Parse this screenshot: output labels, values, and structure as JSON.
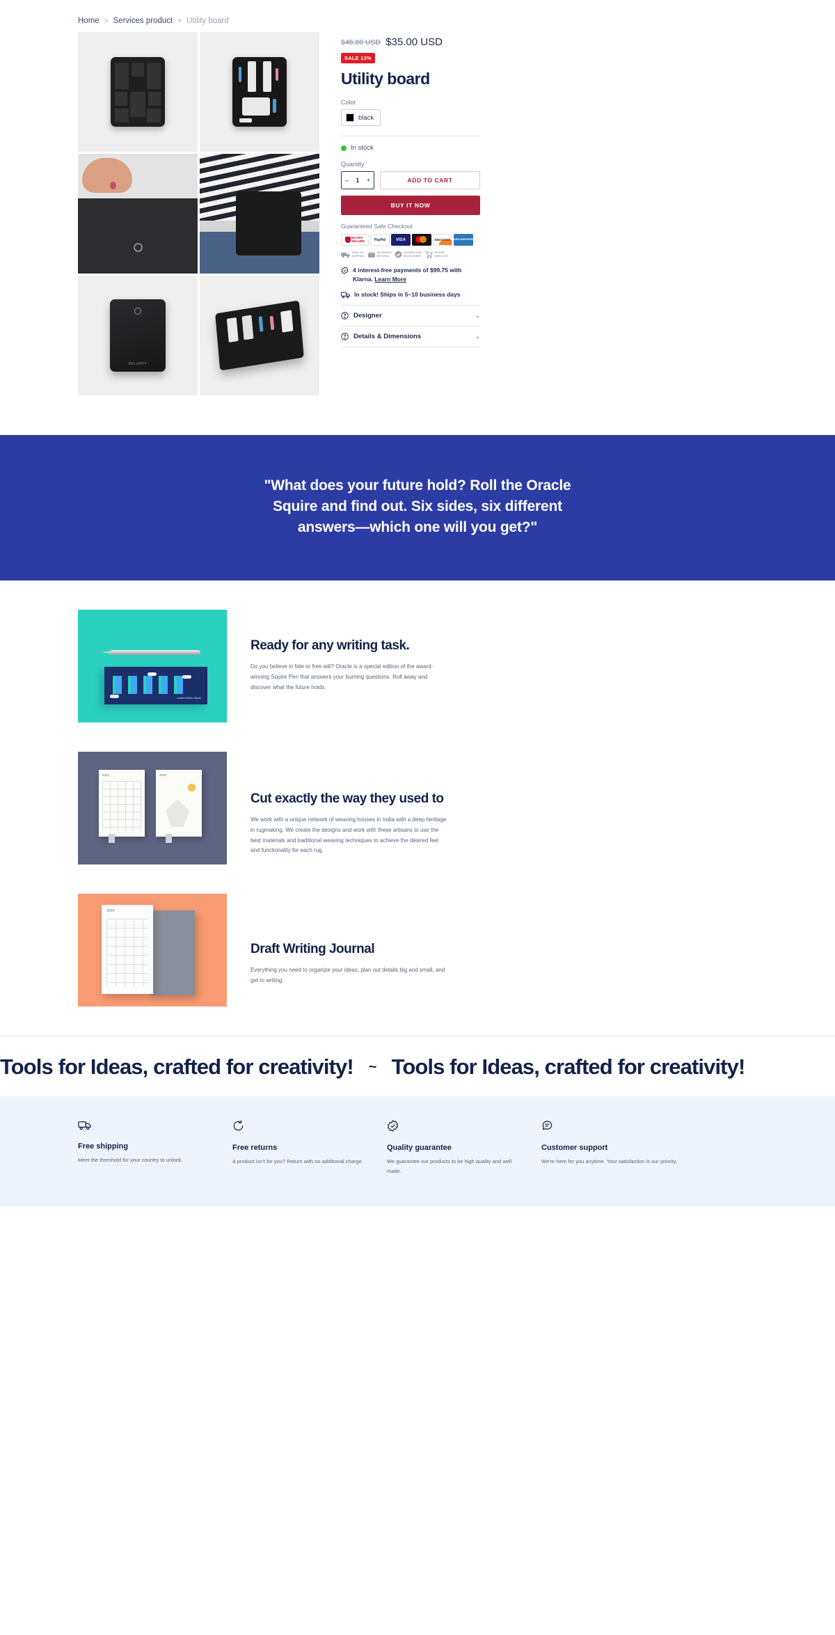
{
  "breadcrumb": {
    "items": [
      {
        "label": "Home",
        "current": false
      },
      {
        "label": "Services product",
        "current": false
      },
      {
        "label": "Utility board",
        "current": true
      }
    ],
    "separator": ">"
  },
  "product": {
    "title": "Utility board",
    "price_old": "$40.00 USD",
    "price_now": "$35.00 USD",
    "sale_badge": "SALE 13%",
    "color_label": "Color",
    "color_value": "black",
    "color_hex": "#000000",
    "stock_label": "In stock",
    "stock_hex": "#27c93f",
    "quantity_label": "Quantity",
    "quantity_value": "1",
    "qty_minus": "–",
    "qty_plus": "+",
    "add_to_cart": "ADD TO CART",
    "buy_it_now": "BUY IT NOW",
    "accent_hex": "#a8223c",
    "safe_checkout_title": "Guaranteed Safe Checkout",
    "payments": [
      {
        "name": "McAfee SECURE",
        "line1": "McAfee",
        "line2": "SECURE"
      },
      {
        "name": "PayPal",
        "line1": "PayPal",
        "line2": ""
      },
      {
        "name": "Visa",
        "line1": "VISA",
        "line2": ""
      },
      {
        "name": "Mastercard",
        "line1": "",
        "line2": ""
      },
      {
        "name": "Discover",
        "line1": "DISCOVER",
        "line2": ""
      },
      {
        "name": "American Express",
        "line1": "AMERICAN",
        "line2": "EXPRESS"
      }
    ],
    "trust_badges": [
      {
        "line1": "FREE U.S.",
        "line2": "SHIPPING"
      },
      {
        "line1": "NO-HASSLE",
        "line2": "RETURNS"
      },
      {
        "line1": "SATISFACTION",
        "line2": "GUARANTEED"
      },
      {
        "line1": "SECURE",
        "line2": "CHECKOUT"
      }
    ],
    "klarna_text": "4 interest-free payments of $99.75 with Klarna.",
    "klarna_link": "Learn More",
    "shipping_text": "In stock! Ships in 5–10 business days",
    "accordions": [
      {
        "label": "Designer"
      },
      {
        "label": "Details & Dimensions"
      }
    ]
  },
  "gallery": {
    "images": [
      {
        "alt": "Utility board closed front, black woven straps"
      },
      {
        "alt": "Utility board open with tools and accessories"
      },
      {
        "alt": "Hand sliding tablet into utility board sleeve"
      },
      {
        "alt": "Person carrying utility board in striped shirt"
      },
      {
        "alt": "Utility board back panel with logo"
      },
      {
        "alt": "Utility board angled view with tools"
      }
    ]
  },
  "quote": {
    "text": "\"What does your future hold? Roll the Oracle Squire and find out. Six sides, six different answers—which one will you get?\"",
    "bg_hex": "#2b3ca5"
  },
  "features": [
    {
      "heading": "Ready for any writing task.",
      "body": "Do you believe in fate or free will? Oracle is a special edition of the award-winning Squire Pen that answers your burning questions. Roll away and discover what the future holds.",
      "image_alt": "Silver Squire pen above a limited edition Utopia box on teal background",
      "image_caption": "Limited Edition Squire",
      "bg_hex": "#2ad1c0"
    },
    {
      "heading": "Cut exactly the way they used to",
      "body": "We work with a unique network of weaving houses in India with a deep heritage in rugmaking. We create the designs and work with these artisans to use the best materials and traditional weaving techniques to achieve the desired feel and functionality for each rug.",
      "image_alt": "Two open illustrated journals on slate background",
      "year_left": "2022",
      "year_right": "2023",
      "bg_hex": "#5d6480"
    },
    {
      "heading": "Draft Writing Journal",
      "body": "Everything you need to organize your ideas, plan out details big and small, and get to writing.",
      "image_alt": "White and grey draft writing journals on peach background",
      "year_left": "2024",
      "bg_hex": "#f89b72"
    }
  ],
  "marquee": {
    "text": "Tools for Ideas, crafted for creativity!",
    "separator": "~"
  },
  "benefits": [
    {
      "icon": "truck-icon",
      "title": "Free shipping",
      "body": "Meet the threshold for your country to unlock."
    },
    {
      "icon": "return-arrow-icon",
      "title": "Free returns",
      "body": "A product isn't for you? Return with no additional charge."
    },
    {
      "icon": "badge-check-icon",
      "title": "Quality guarantee",
      "body": "We guarantee our products to be high quality and well made."
    },
    {
      "icon": "chat-support-icon",
      "title": "Customer support",
      "body": "We're here for you anytime. Your satisfaction is our priority."
    }
  ]
}
